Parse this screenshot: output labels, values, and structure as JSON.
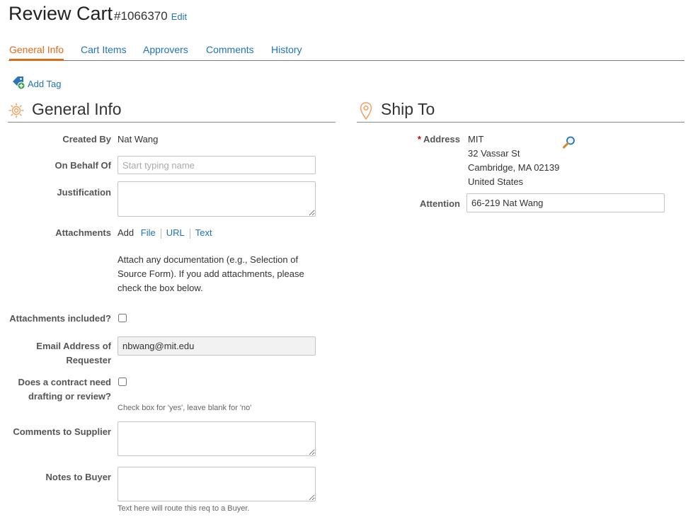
{
  "header": {
    "title": "Review Cart",
    "cart_number": "#1066370",
    "edit_label": "Edit"
  },
  "tabs": [
    {
      "label": "General Info",
      "active": true
    },
    {
      "label": "Cart Items",
      "active": false
    },
    {
      "label": "Approvers",
      "active": false
    },
    {
      "label": "Comments",
      "active": false
    },
    {
      "label": "History",
      "active": false
    }
  ],
  "add_tag_label": "Add Tag",
  "general": {
    "section_title": "General Info",
    "created_by": {
      "label": "Created By",
      "value": "Nat Wang"
    },
    "on_behalf_of": {
      "label": "On Behalf Of",
      "placeholder": "Start typing name",
      "value": ""
    },
    "justification": {
      "label": "Justification",
      "value": ""
    },
    "attachments": {
      "label": "Attachments",
      "add_label": "Add",
      "options": [
        "File",
        "URL",
        "Text"
      ],
      "help_lines": [
        "Attach any documentation (e.g., Selection of",
        "Source Form). If you add attachments, please",
        "check the box below."
      ]
    },
    "attachments_included": {
      "label": "Attachments included?",
      "checked": false
    },
    "email": {
      "label_lines": [
        "Email Address of",
        "Requester"
      ],
      "value": "nbwang@mit.edu"
    },
    "contract_review": {
      "label_lines": [
        "Does a contract need",
        "drafting or review?"
      ],
      "checked": false,
      "hint": "Check box for 'yes', leave blank for 'no'"
    },
    "comments_to_supplier": {
      "label": "Comments to Supplier",
      "value": ""
    },
    "notes_to_buyer": {
      "label": "Notes to Buyer",
      "value": "",
      "hint": "Text here will route this req to a Buyer."
    }
  },
  "ship_to": {
    "section_title": "Ship To",
    "address": {
      "required_marker": "*",
      "label": "Address",
      "lines": [
        "MIT",
        "32 Vassar St",
        "Cambridge, MA 02139",
        "United States"
      ]
    },
    "attention": {
      "label": "Attention",
      "value": "66-219 Nat Wang"
    }
  },
  "colors": {
    "accent": "#e06a1a",
    "link": "#1f73b7",
    "label": "#555555"
  },
  "icons": {
    "add_tag": "tag-plus-icon",
    "general": "gear-icon",
    "ship_to": "map-pin-icon",
    "address_search": "magnifier-icon"
  }
}
